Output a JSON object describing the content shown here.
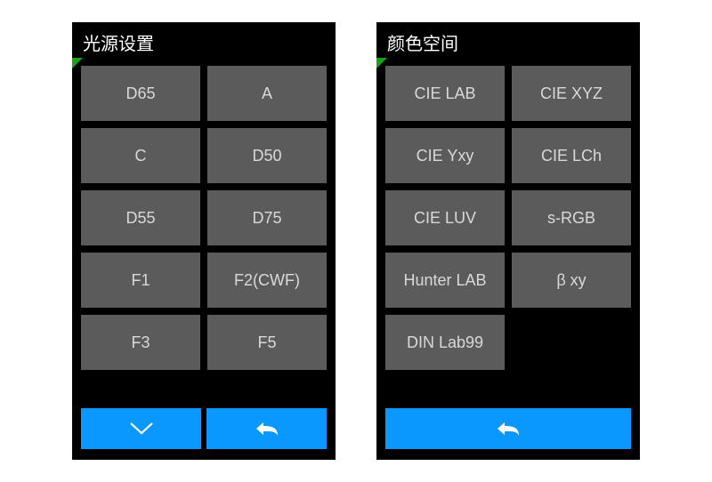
{
  "colors": {
    "accent": "#0a98ff",
    "button_bg": "#5b5b5b",
    "button_fg": "#d9d9d9",
    "panel_bg": "#000000",
    "corner_mark": "#18a31a"
  },
  "panels": {
    "light_source": {
      "title": "光源设置",
      "options": [
        "D65",
        "A",
        "C",
        "D50",
        "D55",
        "D75",
        "F1",
        "F2(CWF)",
        "F3",
        "F5"
      ],
      "footer": {
        "down_icon": "chevron-down",
        "back_icon": "back-arrow"
      }
    },
    "color_space": {
      "title": "颜色空间",
      "options": [
        "CIE LAB",
        "CIE XYZ",
        "CIE Yxy",
        "CIE LCh",
        "CIE LUV",
        "s-RGB",
        "Hunter LAB",
        "β xy",
        "DIN Lab99"
      ],
      "footer": {
        "back_icon": "back-arrow"
      }
    }
  }
}
